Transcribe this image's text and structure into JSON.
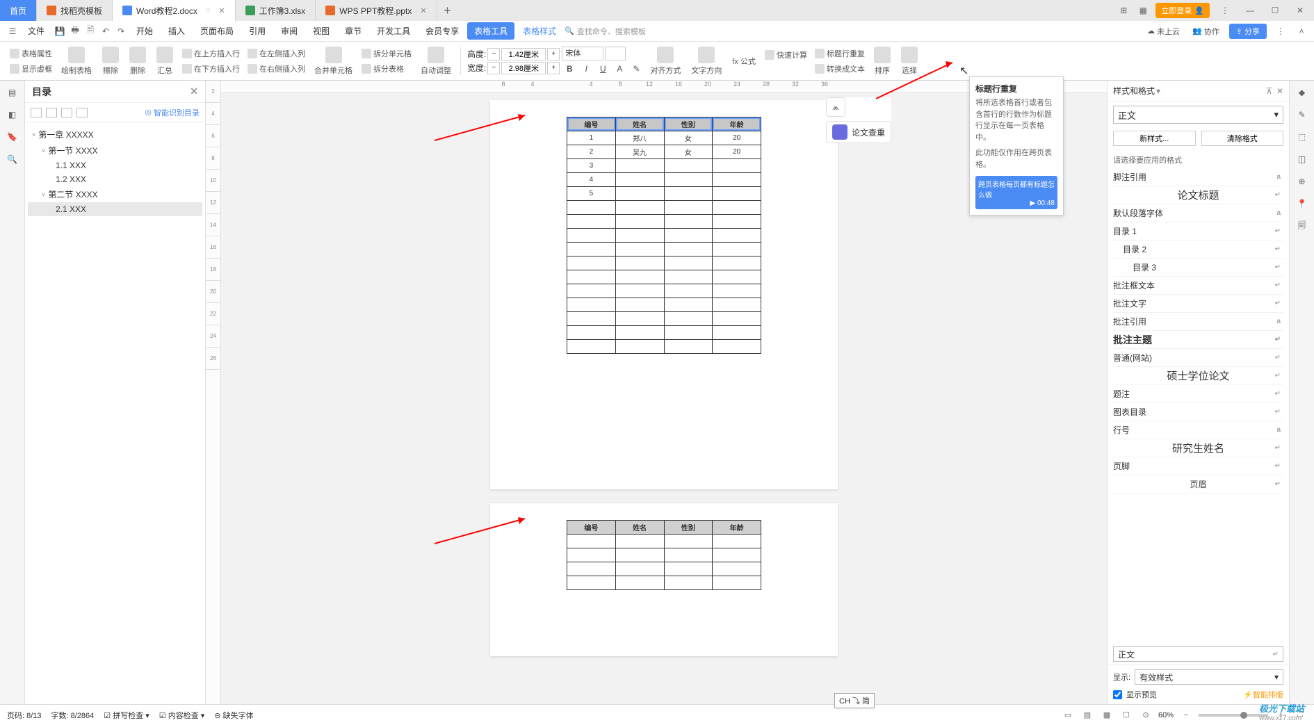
{
  "titlebar": {
    "home": "首页",
    "tabs": [
      {
        "icon": "d",
        "label": "找稻壳模板"
      },
      {
        "icon": "w",
        "label": "Word教程2.docx",
        "active": true,
        "modified": true
      },
      {
        "icon": "s",
        "label": "工作簿3.xlsx"
      },
      {
        "icon": "p",
        "label": "WPS PPT教程.pptx"
      }
    ],
    "login": "立即登录"
  },
  "menubar": {
    "file": "文件",
    "items": [
      "开始",
      "插入",
      "页面布局",
      "引用",
      "审阅",
      "视图",
      "章节",
      "开发工具",
      "会员专享"
    ],
    "active": "表格工具",
    "link": "表格样式",
    "search_hint": "查找命令、搜索模板",
    "right": {
      "cloud": "未上云",
      "coop": "协作",
      "share": "分享"
    }
  },
  "ribbon": {
    "props": "表格属性",
    "show_border": "显示虚框",
    "draw": "绘制表格",
    "erase": "擦除",
    "del": "删除",
    "sum": "汇总",
    "ins_row_up": "在上方插入行",
    "ins_row_down": "在下方插入行",
    "ins_col_left": "在左侧插入列",
    "ins_col_right": "在右侧插入列",
    "merge": "合并单元格",
    "split_cell": "拆分单元格",
    "split_table": "拆分表格",
    "autofit": "自动调整",
    "height_label": "高度:",
    "height_val": "1.42厘米",
    "width_label": "宽度:",
    "width_val": "2.98厘米",
    "font": "宋体",
    "align": "对齐方式",
    "text_dir": "文字方向",
    "fx": "fx 公式",
    "quick_calc": "快速计算",
    "repeat_header": "标题行重复",
    "convert": "转换成文本",
    "sort": "排序",
    "select": "选择"
  },
  "toc": {
    "title": "目录",
    "smart": "智能识别目录",
    "items": [
      {
        "label": "第一章 XXXXX",
        "level": 1,
        "collapsible": true
      },
      {
        "label": "第一节 XXXX",
        "level": 2,
        "collapsible": true
      },
      {
        "label": "1.1 XXX",
        "level": 3
      },
      {
        "label": "1.2 XXX",
        "level": 3
      },
      {
        "label": "第二节 XXXX",
        "level": 2,
        "collapsible": true
      },
      {
        "label": "2.1 XXX",
        "level": 3,
        "selected": true
      }
    ]
  },
  "hruler": [
    "8",
    "4",
    "",
    "4",
    "8",
    "12",
    "16",
    "20",
    "24",
    "28",
    "32",
    "36"
  ],
  "doc": {
    "headers": [
      "编号",
      "姓名",
      "性别",
      "年龄"
    ],
    "rows": [
      [
        "1",
        "郑八",
        "女",
        "20"
      ],
      [
        "2",
        "吴九",
        "女",
        "20"
      ],
      [
        "3",
        "",
        "",
        ""
      ],
      [
        "4",
        "",
        "",
        ""
      ],
      [
        "5",
        "",
        "",
        ""
      ]
    ]
  },
  "float": {
    "lunwen": "论文查重"
  },
  "tooltip": {
    "title": "标题行重复",
    "body1": "将所选表格首行或者包含首行的行数作为标题行显示在每一页表格中。",
    "body2": "此功能仅作用在跨页表格。",
    "video": "跨页表格每页都有标题怎么做",
    "duration": "00:48"
  },
  "rpanel": {
    "title": "样式和格式",
    "current": "正文",
    "new_style": "新样式...",
    "clear": "清除格式",
    "section": "请选择要应用的格式",
    "items": [
      {
        "label": "脚注引用",
        "mark": "a"
      },
      {
        "label": "论文标题",
        "mark": "↵",
        "center": true
      },
      {
        "label": "默认段落字体",
        "mark": "a"
      },
      {
        "label": "目录 1",
        "mark": "↵"
      },
      {
        "label": "目录 2",
        "mark": "↵",
        "indent": 1
      },
      {
        "label": "目录 3",
        "mark": "↵",
        "indent": 2
      },
      {
        "label": "批注框文本",
        "mark": "↵"
      },
      {
        "label": "批注文字",
        "mark": "↵"
      },
      {
        "label": "批注引用",
        "mark": "a"
      },
      {
        "label": "批注主题",
        "mark": "↵",
        "bold": true
      },
      {
        "label": "普通(网站)",
        "mark": "↵"
      },
      {
        "label": "硕士学位论文",
        "mark": "↵",
        "center": true
      },
      {
        "label": "题注",
        "mark": "↵"
      },
      {
        "label": "图表目录",
        "mark": "↵"
      },
      {
        "label": "行号",
        "mark": "a"
      },
      {
        "label": "研究生姓名",
        "mark": "↵",
        "center": true,
        "serif": true
      },
      {
        "label": "页脚",
        "mark": "↵"
      },
      {
        "label": "页眉",
        "mark": "↵",
        "centerText": true
      }
    ],
    "boxed": "正文",
    "show_label": "显示:",
    "show_value": "有效样式",
    "preview": "显示预览",
    "smart": "智能排版"
  },
  "statusbar": {
    "page": "页码: 8/13",
    "words": "字数: 8/2864",
    "spell": "拼写检查",
    "content": "内容检查",
    "font_missing": "缺失字体",
    "zoom": "60%"
  },
  "ime": "CH ⤵ 简"
}
